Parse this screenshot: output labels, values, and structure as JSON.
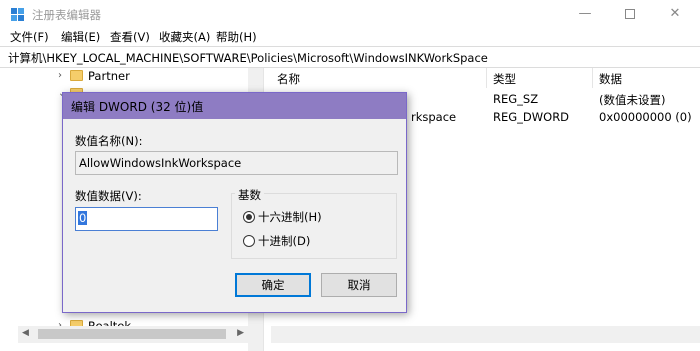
{
  "window": {
    "title": "注册表编辑器",
    "min_symbol": "—",
    "close_symbol": "✕"
  },
  "menu": {
    "items": [
      "文件(F)",
      "编辑(E)",
      "查看(V)",
      "收藏夹(A)",
      "帮助(H)"
    ]
  },
  "address": {
    "path": "计算机\\HKEY_LOCAL_MACHINE\\SOFTWARE\\Policies\\Microsoft\\WindowsINKWorkSpace"
  },
  "tree": {
    "items": [
      {
        "label": "Partner",
        "chevron": "›"
      },
      {
        "label": "Realtek",
        "chevron": "›"
      }
    ]
  },
  "list": {
    "headers": {
      "name": "名称",
      "type": "类型",
      "data": "数据"
    },
    "rows": [
      {
        "name": "",
        "type": "REG_SZ",
        "data": "(数值未设置)"
      },
      {
        "name": "rkspace",
        "type": "REG_DWORD",
        "data": "0x00000000 (0)"
      }
    ]
  },
  "dialog": {
    "title": "编辑 DWORD (32 位)值",
    "name_label": "数值名称(N):",
    "name_value": "AllowWindowsInkWorkspace",
    "data_label": "数值数据(V):",
    "data_value": "0",
    "base_title": "基数",
    "radio_hex": "十六进制(H)",
    "radio_dec": "十进制(D)",
    "base_selected": "hex",
    "ok_label": "确定",
    "cancel_label": "取消"
  },
  "colors": {
    "dialog_title_bg": "#8e7cc3",
    "accent_blue": "#0078d7",
    "folder_yellow": "#f5cd6a"
  }
}
